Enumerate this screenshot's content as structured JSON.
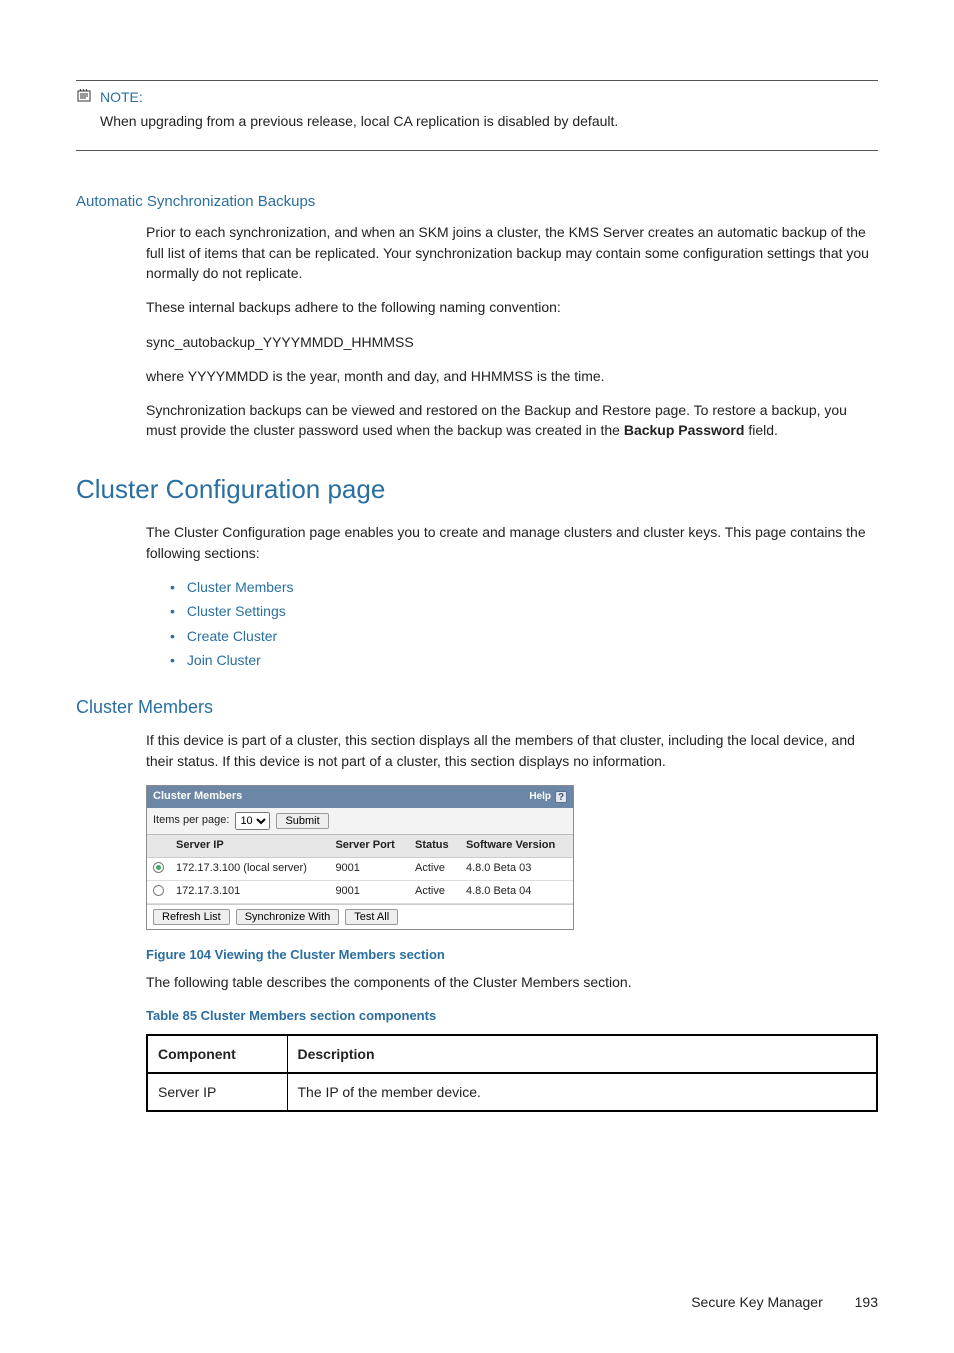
{
  "note": {
    "label": "NOTE:",
    "body": "When upgrading from a previous release, local CA replication is disabled by default."
  },
  "autosync": {
    "heading": "Automatic Synchronization Backups",
    "p1": "Prior to each synchronization, and when an SKM joins a cluster, the KMS Server creates an automatic backup of the full list of items that can be replicated. Your synchronization backup may contain some configuration settings that you normally do not replicate.",
    "p2": "These internal backups adhere to the following naming convention:",
    "p3": "sync_autobackup_YYYYMMDD_HHMMSS",
    "p4": "where YYYYMMDD is the year, month and day, and HHMMSS is the time.",
    "p5a": "Synchronization backups can be viewed and restored on the Backup and Restore page. To restore a backup, you must provide the cluster password used when the backup was created in the ",
    "p5b": "Backup Password",
    "p5c": " field."
  },
  "cluster": {
    "h1": "Cluster Configuration page",
    "intro": "The Cluster Configuration page enables you to create and manage clusters and cluster keys. This page contains the following sections:",
    "links": [
      "Cluster Members",
      "Cluster Settings",
      "Create Cluster",
      "Join Cluster"
    ]
  },
  "members": {
    "heading": "Cluster Members",
    "intro": "If this device is part of a cluster, this section displays all the members of that cluster, including the local device, and their status. If this device is not part of a cluster, this section displays no information."
  },
  "panel": {
    "title": "Cluster Members",
    "help": "Help",
    "items_label": "Items per page:",
    "items_value": "10",
    "submit": "Submit",
    "cols": {
      "ip": "Server IP",
      "port": "Server Port",
      "status": "Status",
      "ver": "Software Version"
    },
    "rows": [
      {
        "selected": true,
        "ip": "172.17.3.100 (local server)",
        "port": "9001",
        "status": "Active",
        "ver": "4.8.0 Beta 03"
      },
      {
        "selected": false,
        "ip": "172.17.3.101",
        "port": "9001",
        "status": "Active",
        "ver": "4.8.0 Beta 04"
      }
    ],
    "buttons": {
      "refresh": "Refresh List",
      "sync": "Synchronize With",
      "test": "Test All"
    }
  },
  "figure_caption": "Figure 104 Viewing the Cluster Members section",
  "after_figure": "The following table describes the components of the Cluster Members section.",
  "table_caption": "Table 85 Cluster Members section components",
  "components_table": {
    "head": {
      "c1": "Component",
      "c2": "Description"
    },
    "row1": {
      "c1": "Server IP",
      "c2": "The IP of the member device."
    }
  },
  "footer": {
    "title": "Secure Key Manager",
    "page": "193"
  }
}
